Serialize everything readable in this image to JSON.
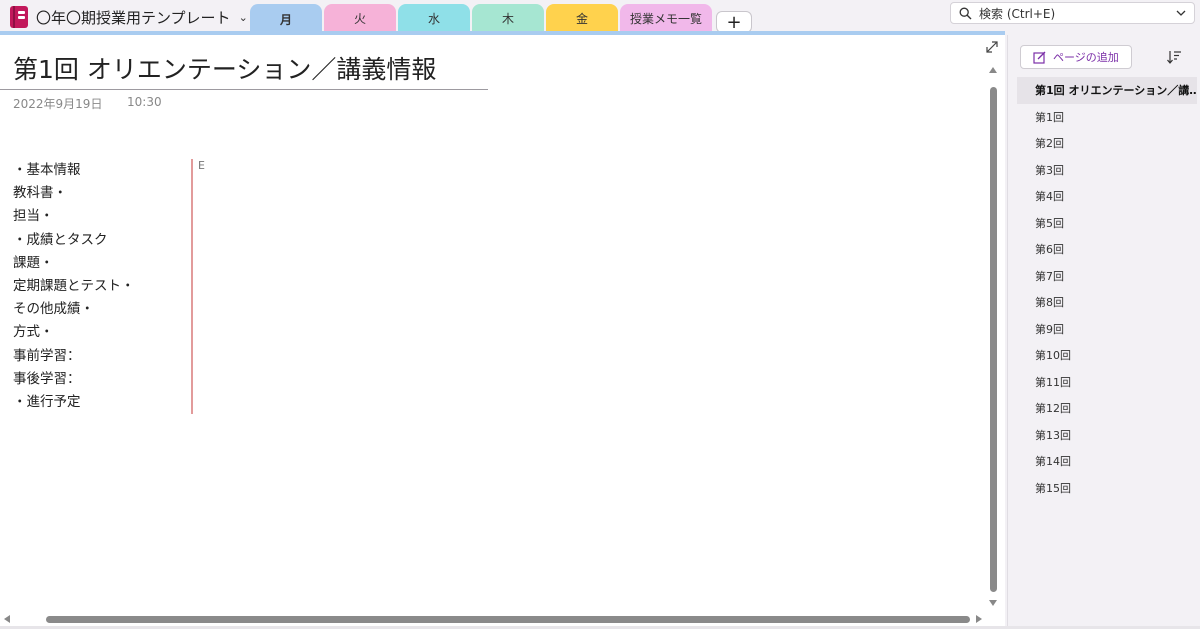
{
  "app": {
    "notebook_title": "〇年〇期授業用テンプレート",
    "search_placeholder": "検索 (Ctrl+E)"
  },
  "colors": {
    "accent_line": "#a9ccf0",
    "add_page_text": "#7b2fa8",
    "notebook_icon": "#c2185b"
  },
  "tabs": [
    {
      "label": "月",
      "color": "#a9ccf0",
      "active": true
    },
    {
      "label": "火",
      "color": "#f6b2d8"
    },
    {
      "label": "水",
      "color": "#8fe0e8"
    },
    {
      "label": "木",
      "color": "#a6e6d2"
    },
    {
      "label": "金",
      "color": "#ffd24d"
    },
    {
      "label": "授業メモ一覧",
      "color": "#f1b8ea"
    }
  ],
  "tab_add_label": "+",
  "page": {
    "title": "第1回 オリエンテーション／講義情報",
    "date": "2022年9月19日",
    "time": "10:30",
    "lines": [
      "・基本情報",
      "教科書・",
      "担当・",
      "・成績とタスク",
      "課題・",
      "定期課題とテスト・",
      "その他成績・",
      "方式・",
      "事前学習：",
      "事後学習：",
      "・進行予定"
    ],
    "side_char": "E"
  },
  "sidebar": {
    "add_page_label": "ページの追加",
    "pages": [
      "第1回 オリエンテーション／講…",
      "第1回",
      "第2回",
      "第3回",
      "第4回",
      "第5回",
      "第6回",
      "第7回",
      "第8回",
      "第9回",
      "第10回",
      "第11回",
      "第12回",
      "第13回",
      "第14回",
      "第15回"
    ]
  }
}
